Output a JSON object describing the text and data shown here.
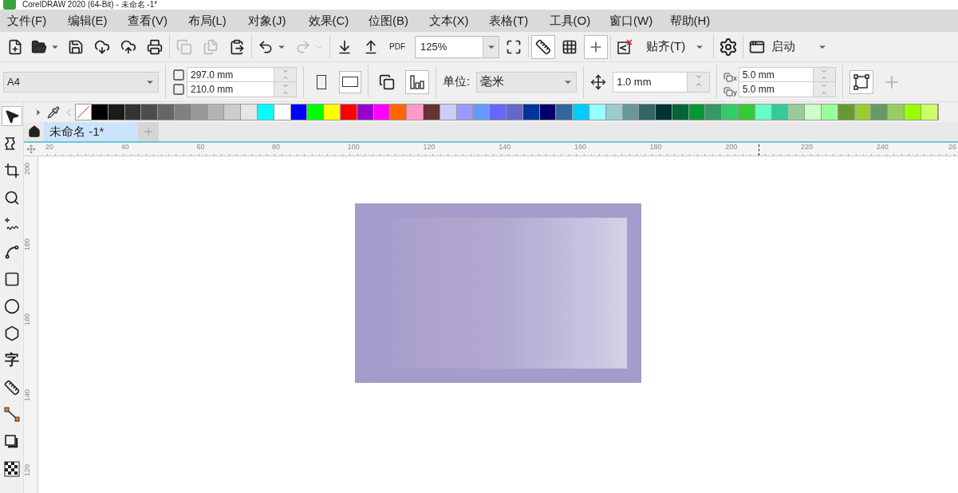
{
  "title_bar": {
    "title": "CorelDRAW 2020 (64-Bit) - 未命名 -1*"
  },
  "menu": [
    "文件(F)",
    "编辑(E)",
    "查看(V)",
    "布局(L)",
    "对象(J)",
    "效果(C)",
    "位图(B)",
    "文本(X)",
    "表格(T)",
    "工具(O)",
    "窗口(W)",
    "帮助(H)"
  ],
  "standard_toolbar": {
    "pdf_label": "PDF",
    "zoom": "125%",
    "view_toggles": [
      {
        "kind": "rulers",
        "on": true
      },
      {
        "kind": "grid",
        "on": false
      },
      {
        "kind": "guidelines",
        "on": true
      }
    ],
    "snap": "贴齐(T)",
    "launch": "启动"
  },
  "property_bar": {
    "page_size": "A4",
    "width": "297.0 mm",
    "height": "210.0 mm",
    "orientation": [
      {
        "kind": "portrait",
        "selected": false
      },
      {
        "kind": "landscape",
        "selected": true
      }
    ],
    "units_label": "单位:",
    "units": "毫米",
    "nudge": "1.0 mm",
    "duplicate": [
      {
        "axis": "x",
        "value": "5.0 mm"
      },
      {
        "axis": "y",
        "value": "5.0 mm"
      }
    ]
  },
  "toolbox": [
    {
      "kind": "pointer",
      "selected": true
    },
    {
      "kind": "shape",
      "selected": false
    },
    {
      "kind": "crop",
      "selected": false
    },
    {
      "kind": "zoom",
      "selected": false
    },
    {
      "kind": "freehand",
      "selected": false
    },
    {
      "kind": "artistic",
      "selected": false
    },
    {
      "kind": "rectangle",
      "selected": false
    },
    {
      "kind": "ellipse",
      "selected": false
    },
    {
      "kind": "polygon",
      "selected": false
    },
    {
      "kind": "text",
      "label": "字",
      "selected": false
    },
    {
      "kind": "dimension",
      "selected": false
    },
    {
      "kind": "connector",
      "selected": false
    },
    {
      "kind": "shadow",
      "selected": false
    },
    {
      "kind": "transparency",
      "selected": false
    }
  ],
  "palette": [
    {
      "color": "#000000"
    },
    {
      "color": "#1a1a1a"
    },
    {
      "color": "#333333"
    },
    {
      "color": "#4d4d4d"
    },
    {
      "color": "#666666"
    },
    {
      "color": "#808080"
    },
    {
      "color": "#999999"
    },
    {
      "color": "#b3b3b3"
    },
    {
      "color": "#cccccc"
    },
    {
      "color": "#e6e6e6"
    },
    {
      "color": "#00ffff"
    },
    {
      "color": "#ffffff"
    },
    {
      "color": "#0000ff"
    },
    {
      "color": "#00ff00"
    },
    {
      "color": "#ffff00"
    },
    {
      "color": "#ff0000"
    },
    {
      "color": "#9900cc"
    },
    {
      "color": "#ff00ff"
    },
    {
      "color": "#ff6600"
    },
    {
      "color": "#ff99cc"
    },
    {
      "color": "#663333"
    },
    {
      "color": "#ccccff"
    },
    {
      "color": "#9999ff"
    },
    {
      "color": "#6699ff"
    },
    {
      "color": "#6666ff"
    },
    {
      "color": "#6666cc"
    },
    {
      "color": "#003399"
    },
    {
      "color": "#000066"
    },
    {
      "color": "#336699"
    },
    {
      "color": "#00ccff"
    },
    {
      "color": "#99ffff"
    },
    {
      "color": "#99cccc"
    },
    {
      "color": "#669999"
    },
    {
      "color": "#336666"
    },
    {
      "color": "#003333"
    },
    {
      "color": "#006633"
    },
    {
      "color": "#009933"
    },
    {
      "color": "#339966"
    },
    {
      "color": "#33cc66"
    },
    {
      "color": "#33cc33"
    },
    {
      "color": "#66ffcc"
    },
    {
      "color": "#33cc99"
    },
    {
      "color": "#99cc99"
    },
    {
      "color": "#ccffcc"
    },
    {
      "color": "#99ff99"
    },
    {
      "color": "#669933"
    },
    {
      "color": "#99cc33"
    },
    {
      "color": "#669966"
    },
    {
      "color": "#99cc66"
    },
    {
      "color": "#99ff00"
    },
    {
      "color": "#ccff66"
    }
  ],
  "document_tabs": [
    {
      "label": "未命名 -1*",
      "selected": true
    }
  ],
  "rulers": {
    "horizontal": [
      "20",
      "40",
      "60",
      "80",
      "100",
      "120",
      "140",
      "160",
      "180",
      "200",
      "220",
      "240",
      "26"
    ],
    "vertical": [
      "200",
      "180",
      "160",
      "140",
      "120"
    ]
  }
}
